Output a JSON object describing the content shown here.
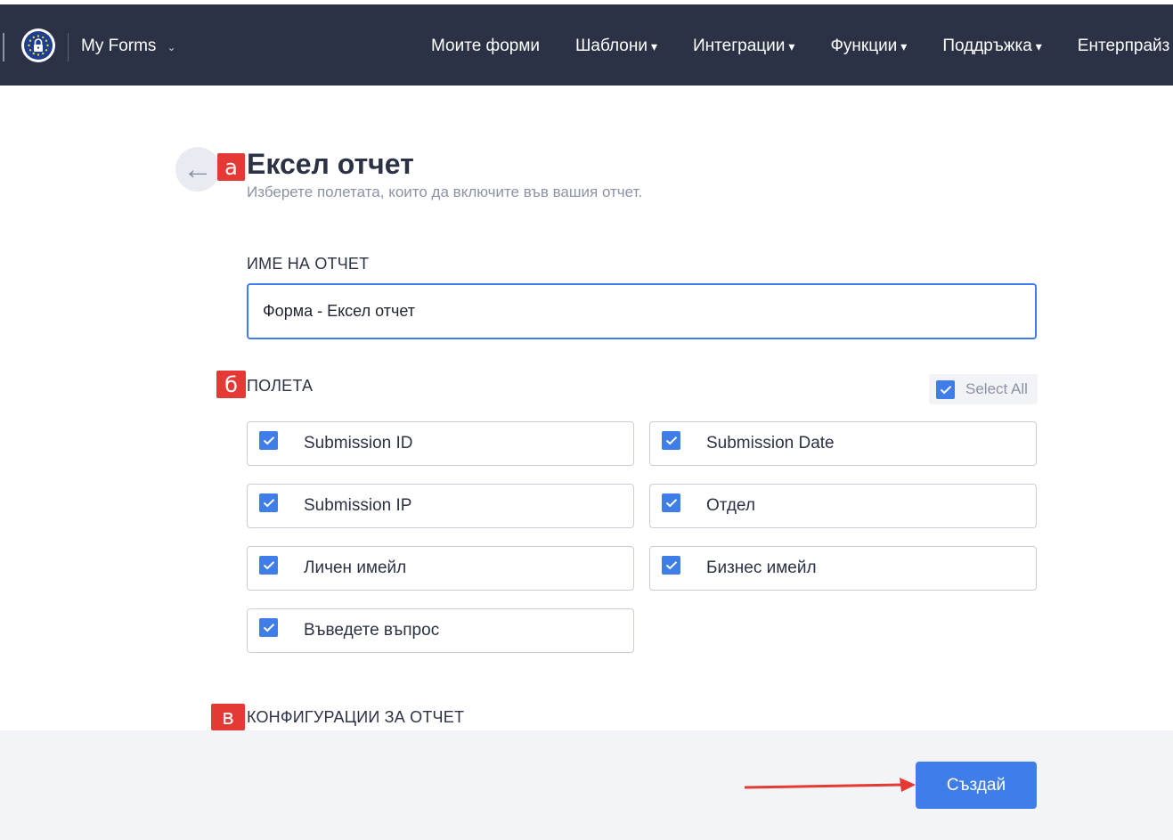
{
  "nav": {
    "logo_icon": "eu-lock-icon",
    "forms_label": "My Forms",
    "items": [
      {
        "label": "Моите форми",
        "caret": ""
      },
      {
        "label": "Шаблони",
        "caret": "▾"
      },
      {
        "label": "Интеграции",
        "caret": "▾"
      },
      {
        "label": "Функции",
        "caret": "▾"
      },
      {
        "label": "Поддръжка",
        "caret": "▾"
      },
      {
        "label": "Ентерпрайз",
        "caret": ""
      }
    ]
  },
  "header": {
    "back_icon": "←",
    "title": "Ексел отчет",
    "subtitle": "Изберете полетата, които да включите във вашия отчет."
  },
  "markers": {
    "a": "а",
    "b": "б",
    "c": "в"
  },
  "report_name": {
    "label": "ИМЕ НА ОТЧЕТ",
    "value": "Форма - Ексел отчет"
  },
  "fields": {
    "label": "ПОЛЕТА",
    "select_all": {
      "label": "Select All",
      "checked": true
    },
    "items": [
      {
        "label": "Submission ID",
        "checked": true
      },
      {
        "label": "Submission Date",
        "checked": true
      },
      {
        "label": "Submission IP",
        "checked": true
      },
      {
        "label": "Отдел",
        "checked": true
      },
      {
        "label": "Личен имейл",
        "checked": true
      },
      {
        "label": "Бизнес имейл",
        "checked": true
      },
      {
        "label": "Въведете въпрос",
        "checked": true
      }
    ]
  },
  "config": {
    "label": "КОНФИГУРАЦИИ ЗА ОТЧЕТ"
  },
  "footer": {
    "create_label": "Създай"
  },
  "colors": {
    "navbar": "#2b3245",
    "accent": "#3f7ee8",
    "marker": "#e53935",
    "annotation_arrow": "#e53935"
  }
}
